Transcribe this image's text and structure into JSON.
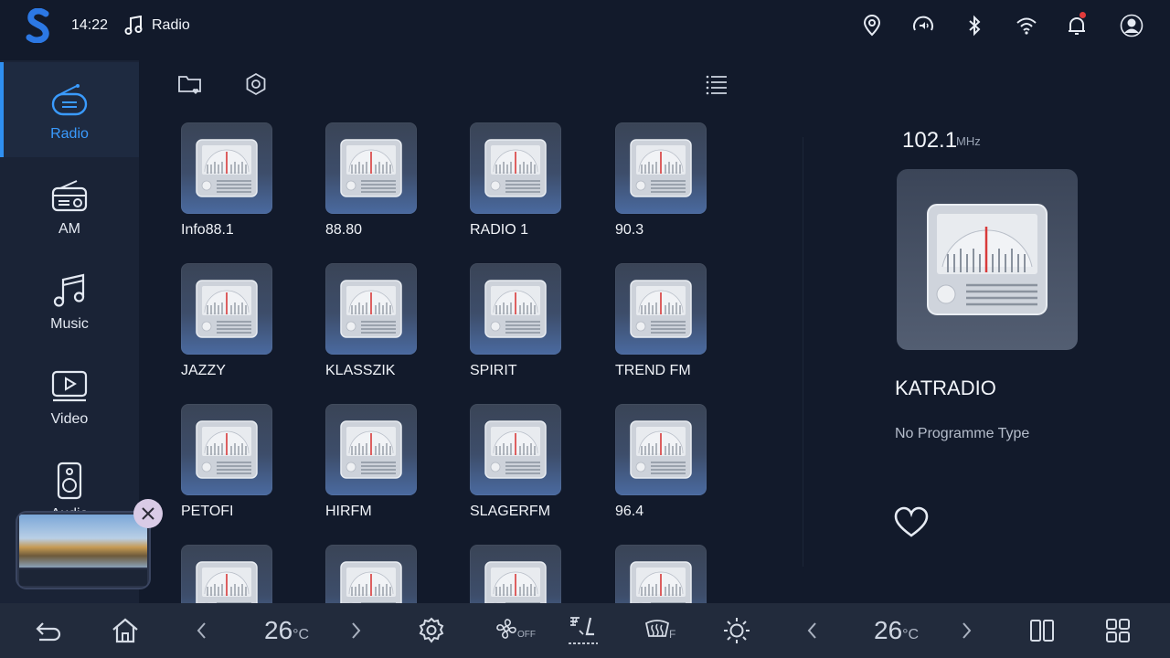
{
  "status_bar": {
    "time": "14:22",
    "app_title": "Radio",
    "icons": [
      "location-icon",
      "speed-volume-icon",
      "bluetooth-icon",
      "wifi-icon",
      "notification-bell-icon",
      "user-avatar-icon"
    ]
  },
  "sidebar": {
    "items": [
      {
        "label": "Radio",
        "icon": "radio-icon",
        "active": true
      },
      {
        "label": "AM",
        "icon": "am-radio-icon",
        "active": false
      },
      {
        "label": "Music",
        "icon": "music-icon",
        "active": false
      },
      {
        "label": "Video",
        "icon": "video-icon",
        "active": false
      },
      {
        "label": "Audio",
        "icon": "speaker-icon",
        "active": false
      }
    ]
  },
  "stations": [
    {
      "name": "Info88.1"
    },
    {
      "name": "88.80"
    },
    {
      "name": "RADIO 1"
    },
    {
      "name": "90.3"
    },
    {
      "name": "JAZZY"
    },
    {
      "name": "KLASSZIK"
    },
    {
      "name": "SPIRIT"
    },
    {
      "name": "TREND FM"
    },
    {
      "name": "PETOFI"
    },
    {
      "name": "HIRFM"
    },
    {
      "name": "SLAGERFM"
    },
    {
      "name": "96.4"
    },
    {
      "name": ""
    },
    {
      "name": ""
    },
    {
      "name": ""
    },
    {
      "name": ""
    }
  ],
  "now_playing": {
    "frequency": "102.1",
    "unit": "MHz",
    "station": "KATRADIO",
    "programme_type": "No Programme Type"
  },
  "bottom_bar": {
    "left_temp": "26",
    "right_temp": "26",
    "temp_unit": "°C",
    "fan_label": "OFF",
    "defrost_label": "F"
  },
  "colors": {
    "accent": "#2f8ff0",
    "background": "#121a2b",
    "sidebar": "#1a2336",
    "bottom_bar": "#222b3c"
  }
}
